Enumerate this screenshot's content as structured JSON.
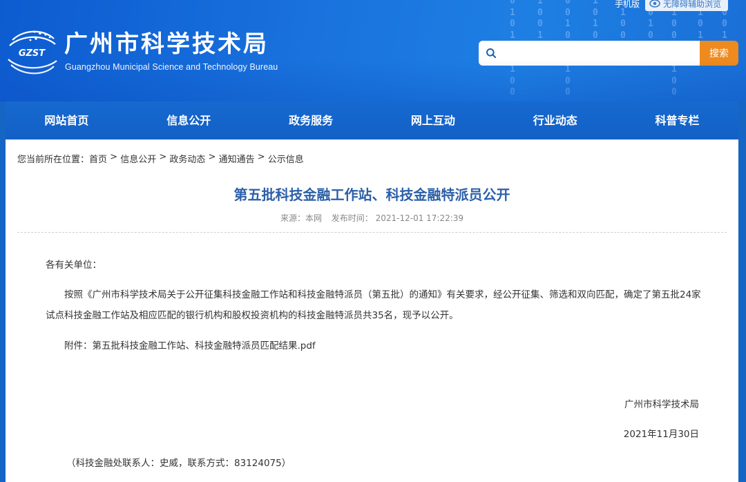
{
  "header": {
    "logo_text": "GZST",
    "title": "广州市科学技术局",
    "subtitle": "Guangzhou Municipal Science and Technology Bureau",
    "mobile_label": "手机版",
    "accessibility_label": "无障碍辅助浏览",
    "search_placeholder": "",
    "search_button": "搜索"
  },
  "nav": {
    "items": [
      {
        "label": "网站首页"
      },
      {
        "label": "信息公开"
      },
      {
        "label": "政务服务"
      },
      {
        "label": "网上互动"
      },
      {
        "label": "行业动态"
      },
      {
        "label": "科普专栏"
      }
    ]
  },
  "breadcrumb": {
    "prefix": "您当前所在位置：",
    "items": [
      "首页",
      "信息公开",
      "政务动态",
      "通知通告",
      "公示信息"
    ],
    "separator": " > "
  },
  "article": {
    "title": "第五批科技金融工作站、科技金融特派员公开",
    "source": "来源：本网",
    "published": "发布时间： 2021-12-01 17:22:39",
    "greeting": "各有关单位：",
    "body": "按照《广州市科学技术局关于公开征集科技金融工作站和科技金融特派员（第五批）的通知》有关要求，经公开征集、筛选和双向匹配，确定了第五批24家试点科技金融工作站及相应匹配的银行机构和股权投资机构的科技金融特派员共35名，现予以公开。",
    "attachment": "附件：第五批科技金融工作站、科技金融特派员匹配结果.pdf",
    "sign_org": "广州市科学技术局",
    "sign_date": "2021年11月30日",
    "contact": "（科技金融处联系人：史威，联系方式：83124075）"
  },
  "colors": {
    "header_blue": "#1a74de",
    "nav_blue": "#1260c6",
    "title_blue": "#2b5fa8",
    "search_orange": "#ee8a1e"
  }
}
